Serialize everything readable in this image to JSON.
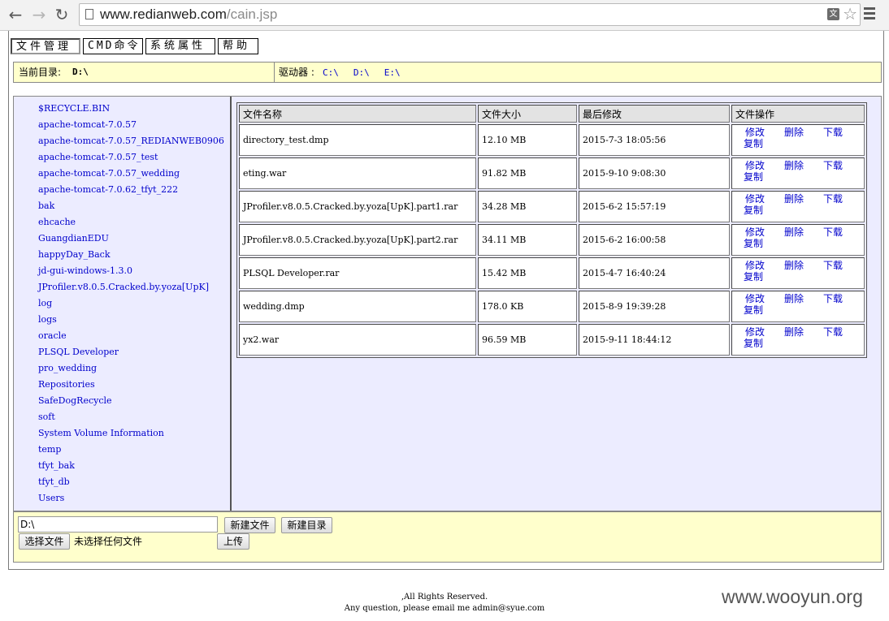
{
  "browser": {
    "url_host": "www.redianweb.com",
    "url_path": "/cain.jsp",
    "back_icon": "←",
    "forward_icon": "→",
    "reload_icon": "↻",
    "translate_icon": "文",
    "star_icon": "☆"
  },
  "tabs": [
    "文件管理",
    "CMD命令",
    "系统属性",
    "帮助"
  ],
  "pathbar": {
    "current_label": "当前目录:",
    "current_dir": "D:\\",
    "drives_label": "驱动器 :",
    "drives": [
      "C:\\",
      "D:\\",
      "E:\\"
    ]
  },
  "dirs": [
    "$RECYCLE.BIN",
    "apache-tomcat-7.0.57",
    "apache-tomcat-7.0.57_REDIANWEB0906",
    "apache-tomcat-7.0.57_test",
    "apache-tomcat-7.0.57_wedding",
    "apache-tomcat-7.0.62_tfyt_222",
    "bak",
    "ehcache",
    "GuangdianEDU",
    "happyDay_Back",
    "jd-gui-windows-1.3.0",
    "JProfiler.v8.0.5.Cracked.by.yoza[UpK]",
    "log",
    "logs",
    "oracle",
    "PLSQL Developer",
    "pro_wedding",
    "Repositories",
    "SafeDogRecycle",
    "soft",
    "System Volume Information",
    "temp",
    "tfyt_bak",
    "tfyt_db",
    "Users"
  ],
  "table": {
    "headers": [
      "文件名称",
      "文件大小",
      "最后修改",
      "文件操作"
    ],
    "ops": [
      "修改",
      "删除",
      "下载",
      "复制"
    ],
    "rows": [
      {
        "name": "directory_test.dmp",
        "size": "12.10 MB",
        "modified": "2015-7-3 18:05:56"
      },
      {
        "name": "eting.war",
        "size": "91.82 MB",
        "modified": "2015-9-10 9:08:30"
      },
      {
        "name": "JProfiler.v8.0.5.Cracked.by.yoza[UpK].part1.rar",
        "size": "34.28 MB",
        "modified": "2015-6-2 15:57:19"
      },
      {
        "name": "JProfiler.v8.0.5.Cracked.by.yoza[UpK].part2.rar",
        "size": "34.11 MB",
        "modified": "2015-6-2 16:00:58"
      },
      {
        "name": "PLSQL Developer.rar",
        "size": "15.42 MB",
        "modified": "2015-4-7 16:40:24"
      },
      {
        "name": "wedding.dmp",
        "size": "178.0 KB",
        "modified": "2015-8-9 19:39:28"
      },
      {
        "name": "yx2.war",
        "size": "96.59 MB",
        "modified": "2015-9-11 18:44:12"
      }
    ]
  },
  "upload": {
    "path_value": "D:\\",
    "new_file_label": "新建文件",
    "new_dir_label": "新建目录",
    "choose_file_label": "选择文件",
    "no_file_text": "未选择任何文件",
    "upload_label": "上传"
  },
  "footer": {
    "line1": ",All Rights Reserved.",
    "line2": "Any question, please email me admin@syue.com"
  },
  "watermark": "www.wooyun.org"
}
